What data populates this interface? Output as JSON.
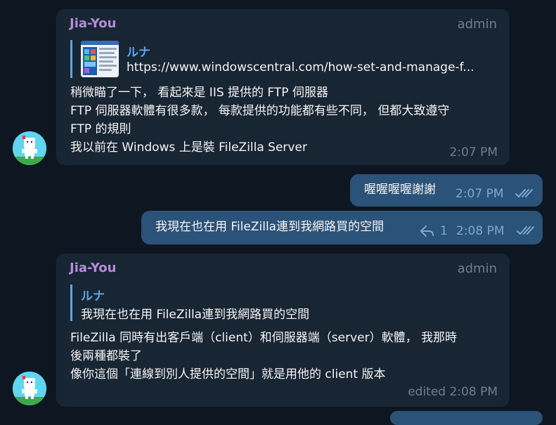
{
  "messages": [
    {
      "sender": "Jia-You",
      "role": "admin",
      "reply_to": {
        "name": "ルナ",
        "text": "https://www.windowscentral.com/how-set-and-manage-f..."
      },
      "lines": [
        "稍微瞄了一下， 看起來是 IIS 提供的 FTP 伺服器",
        "FTP 伺服器軟體有很多款， 每款提供的功能都有些不同， 但都大致遵守",
        "FTP 的規則",
        "我以前在 Windows 上是裝 FileZilla Server"
      ],
      "time": "2:07 PM"
    },
    {
      "text": "喔喔喔喔謝謝",
      "time": "2:07 PM"
    },
    {
      "text": "我現在也在用 FileZilla連到我網路買的空間",
      "reply_count": "1",
      "time": "2:08 PM"
    },
    {
      "sender": "Jia-You",
      "role": "admin",
      "reply_to": {
        "name": "ルナ",
        "text": "我現在也在用 FileZilla連到我網路買的空間"
      },
      "lines": [
        "FileZilla 同時有出客戶端（client）和伺服器端（server）軟體， 我那時",
        "後兩種都裝了",
        "像你這個「連線到別人提供的空間」就是用他的 client 版本"
      ],
      "time": "edited 2:08 PM"
    }
  ],
  "colors": {
    "background": "#0e1621",
    "incoming_bubble": "#182533",
    "outgoing_bubble": "#2b5278",
    "sender_name": "#b48bd8",
    "reply_accent": "#5aa6ea",
    "meta_text": "#6d7f8f"
  }
}
